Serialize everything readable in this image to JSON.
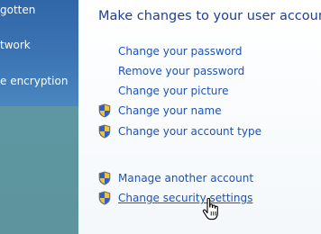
{
  "nav": {
    "items": [
      {
        "label": "gotten"
      },
      {
        "label": "twork"
      },
      {
        "label": "e encryption"
      }
    ]
  },
  "main": {
    "title": "Make changes to your user account",
    "links": [
      {
        "label": "Change your password",
        "shield": false
      },
      {
        "label": "Remove your password",
        "shield": false
      },
      {
        "label": "Change your picture",
        "shield": false
      },
      {
        "label": "Change your name",
        "shield": true
      },
      {
        "label": "Change your account type",
        "shield": true
      }
    ],
    "other_links": [
      {
        "label": "Manage another account",
        "shield": true
      },
      {
        "label": "Change security settings",
        "shield": true,
        "hovered": true
      }
    ]
  },
  "colors": {
    "link": "#1d52b8",
    "title": "#1f3f92",
    "nav_text": "#ffffff"
  },
  "icons": {
    "uac_shield": "uac-shield-icon",
    "cursor": "hand-pointer-cursor"
  }
}
